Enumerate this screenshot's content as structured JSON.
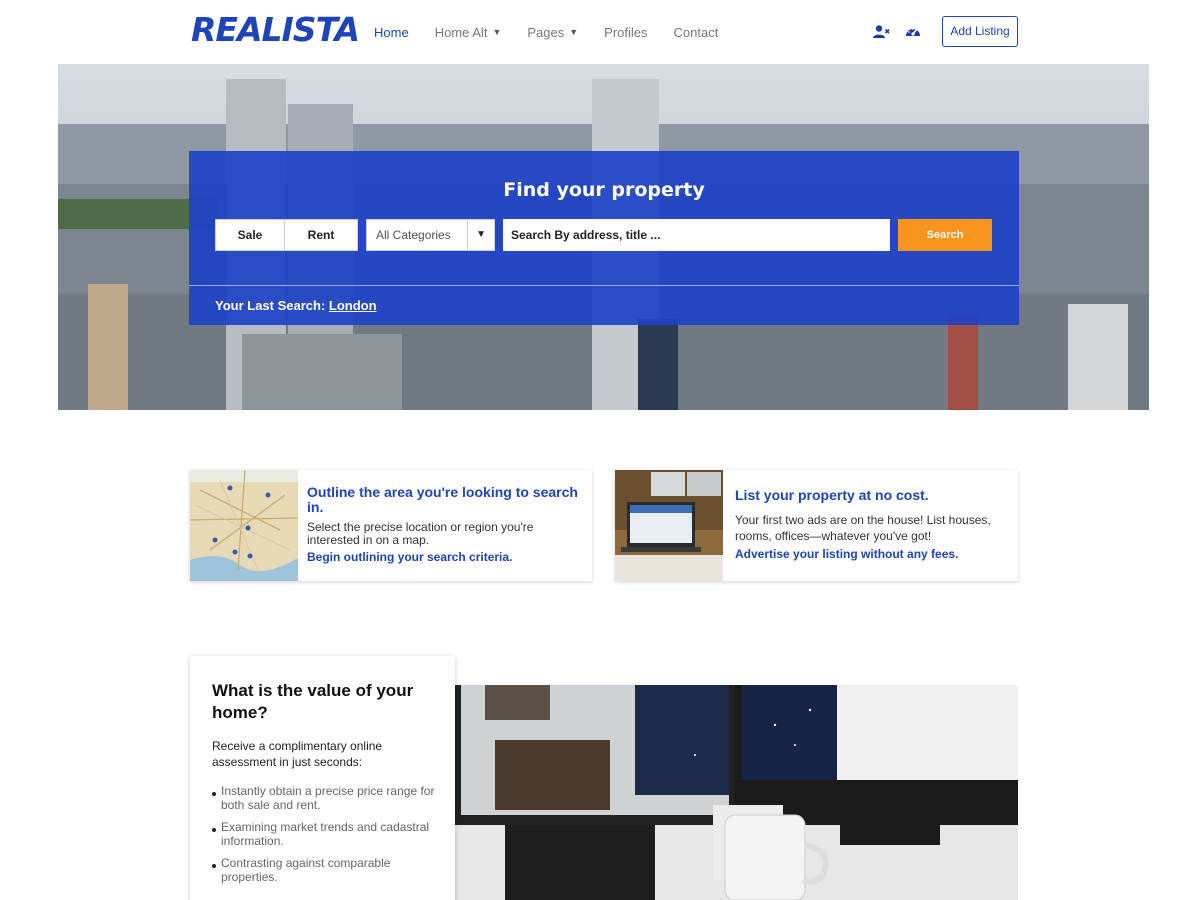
{
  "header": {
    "logo_text": "REALISTA",
    "nav": [
      {
        "label": "Home",
        "active": true,
        "has_dropdown": false
      },
      {
        "label": "Home Alt",
        "active": false,
        "has_dropdown": true
      },
      {
        "label": "Pages",
        "active": false,
        "has_dropdown": true
      },
      {
        "label": "Profiles",
        "active": false,
        "has_dropdown": false
      },
      {
        "label": "Contact",
        "active": false,
        "has_dropdown": false
      }
    ],
    "icons": [
      "user-add-icon",
      "dashboard-icon"
    ],
    "add_listing_label": "Add Listing"
  },
  "hero": {
    "title": "Find your property",
    "tabs": [
      "Sale",
      "Rent"
    ],
    "category_value": "All Categories",
    "search_placeholder": "Search By address, title ...",
    "search_button": "Search",
    "last_search_label": "Your Last Search:",
    "last_search_value": "London"
  },
  "features": [
    {
      "image": "map-thumbnail",
      "title": "Outline the area you're looking to search in.",
      "text": "Select the precise location or region you're interested in on a map.",
      "link": "Begin outlining your search criteria."
    },
    {
      "image": "laptop-thumbnail",
      "title": "List your property at no cost.",
      "text": "Your first two ads are on the house! List houses, rooms, offices—whatever you've got!",
      "link": "Advertise your listing without any fees."
    }
  ],
  "valuation": {
    "title": "What is the value of your home?",
    "intro": "Receive a complimentary online assessment in just seconds:",
    "points": [
      "Instantly obtain a precise price range for both sale and rent.",
      "Examining market trends and cadastral information.",
      "Contrasting against comparable properties."
    ]
  },
  "colors": {
    "brand_blue": "#1e44b9",
    "search_orange": "#f7941d",
    "search_panel": "#1e42c8"
  }
}
